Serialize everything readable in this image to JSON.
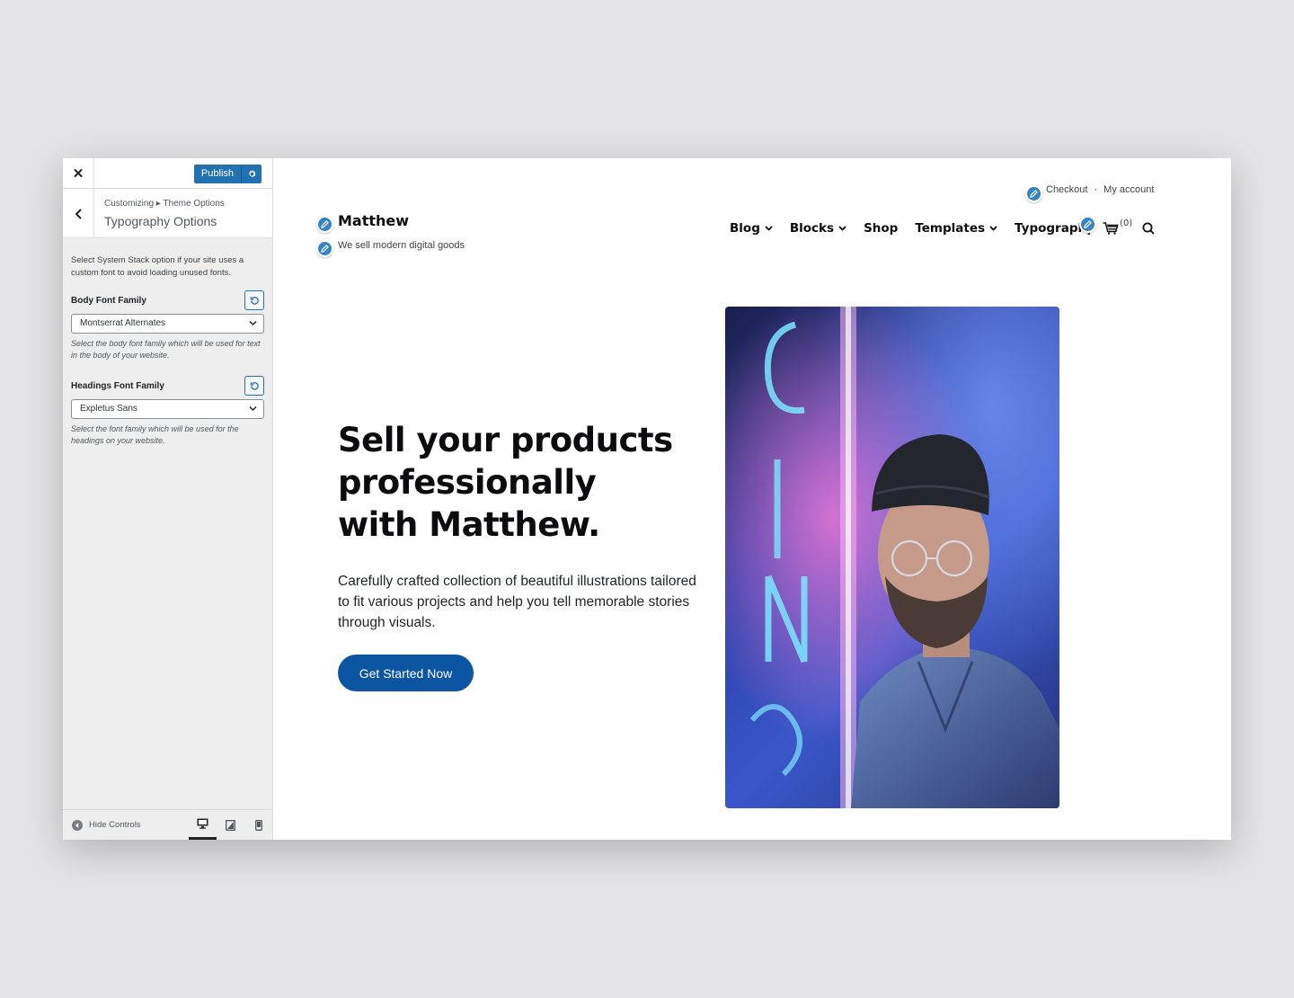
{
  "customizer": {
    "publish_label": "Publish",
    "breadcrumb": "Customizing ▸ Theme Options",
    "section_title": "Typography Options",
    "intro": "Select System Stack option if your site uses a custom font to avoid loading unused fonts.",
    "body_font": {
      "label": "Body Font Family",
      "value": "Montserrat Alternates",
      "description": "Select the body font family which will be used for text in the body of your website."
    },
    "headings_font": {
      "label": "Headings Font Family",
      "value": "Expletus Sans",
      "description": "Select the font family which will be used for the headings on your website."
    },
    "hide_controls_label": "Hide Controls",
    "active_device": "desktop",
    "accent_color": "#2271b1"
  },
  "site": {
    "title": "Matthew",
    "tagline": "We sell modern digital goods",
    "top_links": [
      "Checkout",
      "My account"
    ],
    "top_link_separator": "·",
    "nav": [
      "Blog",
      "Blocks",
      "Shop",
      "Templates",
      "Typography"
    ],
    "cart_count": "(0)",
    "hero": {
      "title": "Sell your products professionally with Matthew.",
      "text": "Carefully crafted collection of beautiful illustrations tailored to fit various projects and help you tell memorable stories through visuals.",
      "button": "Get Started Now",
      "button_color": "#0b55a3"
    }
  }
}
